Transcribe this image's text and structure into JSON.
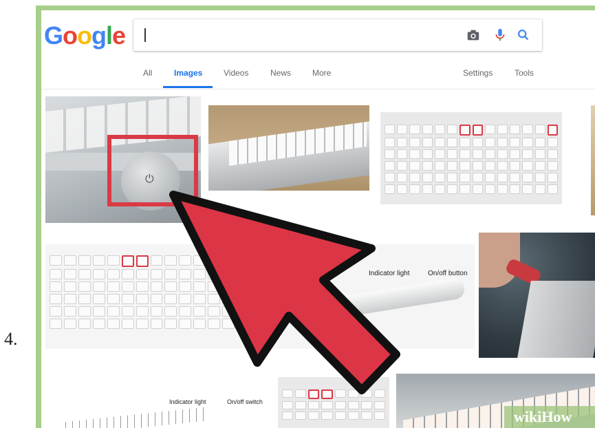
{
  "step_number": "4.",
  "logo": {
    "letters": [
      "G",
      "o",
      "o",
      "g",
      "l",
      "e"
    ],
    "colors": [
      "#4285F4",
      "#EA4335",
      "#FBBC05",
      "#4285F4",
      "#34A853",
      "#EA4335"
    ]
  },
  "search": {
    "value": "",
    "icons": [
      "camera-icon",
      "microphone-icon",
      "search-icon"
    ]
  },
  "tabs": {
    "items": [
      "All",
      "Images",
      "Videos",
      "News",
      "More"
    ],
    "active": "Images",
    "right": [
      "Settings",
      "Tools"
    ]
  },
  "results": {
    "image4_labels": {
      "indicator": "Indicator light",
      "onoff": "On/off button"
    },
    "image6_labels": {
      "indicator": "Indicator light",
      "onoff": "On/off switch"
    }
  },
  "highlight_color": "#d93a45",
  "arrow_color": "#dc3545",
  "watermark": "wikiHow"
}
